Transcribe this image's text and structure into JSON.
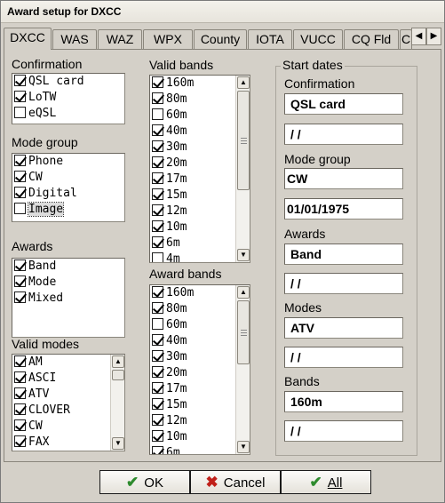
{
  "window": {
    "title": "Award setup for DXCC"
  },
  "tabs": [
    "DXCC",
    "WAS",
    "WAZ",
    "WPX",
    "County",
    "IOTA",
    "VUCC",
    "CQ Fld",
    "C"
  ],
  "tab_scroll": {
    "left_icon": "arrow-left-icon",
    "right_icon": "arrow-right-icon"
  },
  "confirmation": {
    "label": "Confirmation",
    "items": [
      {
        "label": "QSL card",
        "checked": true
      },
      {
        "label": "LoTW",
        "checked": true
      },
      {
        "label": "eQSL",
        "checked": false
      }
    ]
  },
  "mode_group": {
    "label": "Mode group",
    "items": [
      {
        "label": "Phone",
        "checked": true
      },
      {
        "label": "CW",
        "checked": true
      },
      {
        "label": "Digital",
        "checked": true
      },
      {
        "label": "Image",
        "checked": false,
        "focused": true
      }
    ]
  },
  "awards": {
    "label": "Awards",
    "items": [
      {
        "label": "Band",
        "checked": true
      },
      {
        "label": "Mode",
        "checked": true
      },
      {
        "label": "Mixed",
        "checked": true
      }
    ]
  },
  "valid_modes": {
    "label": "Valid modes",
    "items": [
      {
        "label": "AM",
        "checked": true
      },
      {
        "label": "ASCI",
        "checked": true
      },
      {
        "label": "ATV",
        "checked": true
      },
      {
        "label": "CLOVER",
        "checked": true
      },
      {
        "label": "CW",
        "checked": true
      },
      {
        "label": "FAX",
        "checked": true
      }
    ]
  },
  "valid_bands": {
    "label": "Valid bands",
    "items": [
      {
        "label": "160m",
        "checked": true
      },
      {
        "label": "80m",
        "checked": true
      },
      {
        "label": "60m",
        "checked": false
      },
      {
        "label": "40m",
        "checked": true
      },
      {
        "label": "30m",
        "checked": true
      },
      {
        "label": "20m",
        "checked": true
      },
      {
        "label": "17m",
        "checked": true
      },
      {
        "label": "15m",
        "checked": true
      },
      {
        "label": "12m",
        "checked": true
      },
      {
        "label": "10m",
        "checked": true
      },
      {
        "label": "6m",
        "checked": true
      },
      {
        "label": "4m",
        "checked": false
      }
    ]
  },
  "award_bands": {
    "label": "Award bands",
    "items": [
      {
        "label": "160m",
        "checked": true
      },
      {
        "label": "80m",
        "checked": true
      },
      {
        "label": "60m",
        "checked": false
      },
      {
        "label": "40m",
        "checked": true
      },
      {
        "label": "30m",
        "checked": true
      },
      {
        "label": "20m",
        "checked": true
      },
      {
        "label": "17m",
        "checked": true
      },
      {
        "label": "15m",
        "checked": true
      },
      {
        "label": "12m",
        "checked": true
      },
      {
        "label": "10m",
        "checked": true
      },
      {
        "label": "6m",
        "checked": true
      }
    ]
  },
  "start_dates": {
    "title": "Start dates",
    "confirmation": {
      "label": "Confirmation",
      "value": "QSL card",
      "date": " / /"
    },
    "mode_group": {
      "label": "Mode group",
      "value": "CW",
      "date": "01/01/1975"
    },
    "awards": {
      "label": "Awards",
      "value": "Band",
      "date": " / /"
    },
    "modes": {
      "label": "Modes",
      "value": "ATV",
      "date": " / /"
    },
    "bands": {
      "label": "Bands",
      "value": "160m",
      "date": " / /"
    }
  },
  "buttons": {
    "ok": {
      "label": "OK",
      "icon": "checkmark-icon",
      "color": "#2e8b2e"
    },
    "cancel": {
      "label": "Cancel",
      "icon": "x-icon",
      "color": "#c0201a"
    },
    "all": {
      "label": "All",
      "icon": "double-checkmark-icon",
      "color": "#2e8b2e"
    }
  }
}
